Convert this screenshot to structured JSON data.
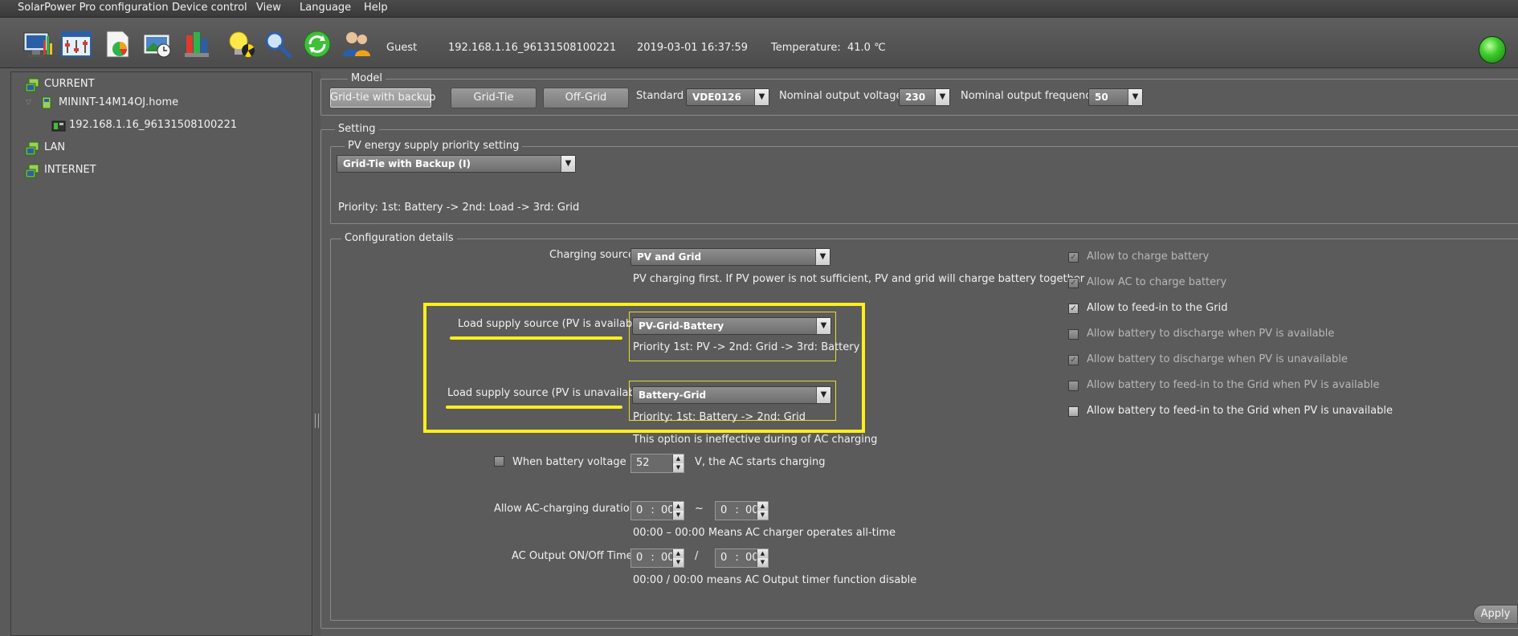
{
  "menu": [
    "SolarPower Pro configuration",
    "Device control",
    "View",
    "Language",
    "Help"
  ],
  "toolbar": {
    "icons": [
      "monitor-chart-icon",
      "parameter-settings-icon",
      "data-report-icon",
      "event-log-icon",
      "data-collect-icon",
      "bulb-icon",
      "search-icon",
      "refresh-icon",
      "users-icon"
    ],
    "user": "Guest",
    "device_id": "192.168.1.16_96131508100221",
    "datetime": "2019-03-01 16:37:59",
    "temperature_label": "Temperature:",
    "temperature_value": "41.0 ℃"
  },
  "tree": {
    "current": "CURRENT",
    "host": "MININT-14M14OJ.home",
    "device": "192.168.1.16_96131508100221",
    "lan": "LAN",
    "internet": "INTERNET"
  },
  "model": {
    "title": "Model",
    "buttons": [
      "Grid-tie with backup",
      "Grid-Tie",
      "Off-Grid"
    ],
    "standard_label": "Standard",
    "standard_value": "VDE0126",
    "voltage_label": "Nominal output voltage",
    "voltage_value": "230",
    "frequency_label": "Nominal output frequency",
    "frequency_value": "50"
  },
  "setting": {
    "title": "Setting",
    "pv_priority_title": "PV energy supply priority setting",
    "pv_priority_value": "Grid-Tie with Backup (I)",
    "priority_text": "Priority: 1st: Battery -> 2nd: Load -> 3rd: Grid"
  },
  "config": {
    "title": "Configuration details",
    "charging_source_label": "Charging source",
    "charging_source_value": "PV and Grid",
    "charging_source_note": "PV charging first. If PV power is not sufficient, PV and grid will charge battery together",
    "load_pv_avail_label": "Load supply source (PV is available)",
    "load_pv_avail_value": "PV-Grid-Battery",
    "load_pv_avail_note": "Priority 1st: PV -> 2nd: Grid -> 3rd: Battery",
    "load_pv_unavail_label": "Load supply source (PV is unavailable)",
    "load_pv_unavail_value": "Battery-Grid",
    "load_pv_unavail_note": "Priority: 1st: Battery -> 2nd: Grid",
    "ac_charging_note": "This option is ineffective during of AC charging",
    "battery_voltage_label": "When battery voltage <",
    "battery_voltage_value": "52",
    "battery_voltage_suffix": "V, the AC starts charging",
    "ac_duration_label": "Allow AC-charging duration",
    "ac_duration_start_h": "0",
    "ac_duration_start_m": "00",
    "ac_duration_sep": "~",
    "ac_duration_end_h": "0",
    "ac_duration_end_m": "00",
    "ac_duration_note": "00:00 – 00:00 Means AC charger operates all-time",
    "ac_timer_label": "AC Output ON/Off Timer",
    "ac_timer_on_h": "0",
    "ac_timer_on_m": "00",
    "ac_timer_sep": "/",
    "ac_timer_off_h": "0",
    "ac_timer_off_m": "00",
    "ac_timer_note": "00:00 / 00:00 means AC Output timer function disable",
    "time_colon": ":"
  },
  "checkboxes": [
    {
      "label": "Allow to charge battery",
      "checked": "✓",
      "enabled": false
    },
    {
      "label": "Allow AC to charge battery",
      "checked": "✓",
      "enabled": false
    },
    {
      "label": "Allow to feed-in to the Grid",
      "checked": "✓",
      "enabled": true
    },
    {
      "label": "Allow battery to discharge when PV is available",
      "checked": "",
      "enabled": false
    },
    {
      "label": "Allow battery to discharge when PV is unavailable",
      "checked": "✓",
      "enabled": false
    },
    {
      "label": "Allow battery to feed-in to the Grid when PV is available",
      "checked": "",
      "enabled": false
    },
    {
      "label": "Allow battery to feed-in to the Grid when PV is unavailable",
      "checked": "",
      "enabled": true
    }
  ],
  "apply_label": "Apply",
  "colors": {
    "highlight": "#ffef1a",
    "led": "#3fcc2c"
  }
}
